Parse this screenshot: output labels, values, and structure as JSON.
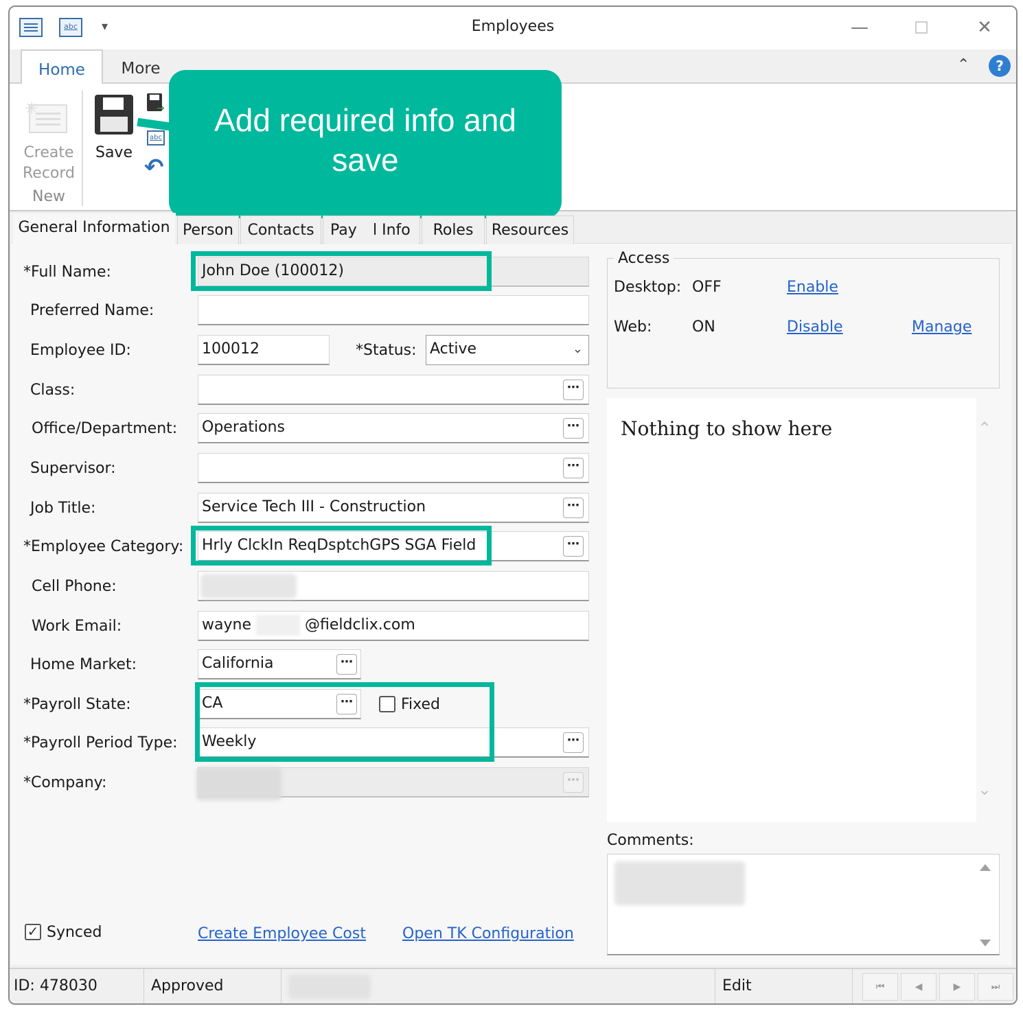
{
  "window": {
    "title": "Employees"
  },
  "ribbon": {
    "tabs": [
      {
        "label": "Home"
      },
      {
        "label": "More"
      }
    ],
    "create_record_label": "Create\nRecord",
    "group_new_label": "New",
    "save_label": "Save"
  },
  "callout": {
    "text": "Add required info and\nsave"
  },
  "form_tabs": [
    {
      "label": "General Information"
    },
    {
      "label": "Person"
    },
    {
      "label": "Contacts"
    },
    {
      "label": "Payroll Info"
    },
    {
      "label": "Roles"
    },
    {
      "label": "Resources"
    }
  ],
  "payroll_tab_left": "Pay",
  "payroll_tab_right": "l Info",
  "form": {
    "full_name": {
      "label": "*Full Name:",
      "value": "John Doe (100012)"
    },
    "preferred_name": {
      "label": "Preferred Name:",
      "value": ""
    },
    "employee_id": {
      "label": "Employee ID:",
      "value": "100012"
    },
    "status": {
      "label": "*Status:",
      "value": "Active"
    },
    "class": {
      "label": "Class:",
      "value": ""
    },
    "office_department": {
      "label": "Office/Department:",
      "value": "Operations"
    },
    "supervisor": {
      "label": "Supervisor:",
      "value": ""
    },
    "job_title": {
      "label": "Job Title:",
      "value": "Service Tech III - Construction"
    },
    "employee_category": {
      "label": "*Employee Category:",
      "value": "Hrly ClckIn ReqDsptchGPS SGA Field"
    },
    "cell_phone": {
      "label": "Cell Phone:",
      "value": ""
    },
    "work_email": {
      "label": "Work Email:",
      "value_prefix": "wayne",
      "value_suffix": "@fieldclix.com"
    },
    "home_market": {
      "label": "Home Market:",
      "value": "California"
    },
    "payroll_state": {
      "label": "*Payroll State:",
      "value": "CA",
      "fixed_label": "Fixed",
      "fixed_checked": false
    },
    "payroll_period_type": {
      "label": "*Payroll Period Type:",
      "value": "Weekly"
    },
    "company": {
      "label": "*Company:",
      "value": ""
    },
    "ellipsis": "⋯"
  },
  "access": {
    "title": "Access",
    "desktop": {
      "label": "Desktop:",
      "value": "OFF",
      "action": "Enable"
    },
    "web": {
      "label": "Web:",
      "value": "ON",
      "action": "Disable",
      "manage": "Manage"
    }
  },
  "side_panel": {
    "empty_text": "Nothing to show here"
  },
  "comments": {
    "label": "Comments:"
  },
  "footer": {
    "synced_label": "Synced",
    "synced_checked": true,
    "create_cost_link": "Create Employee Cost",
    "open_tk_link": "Open TK Configuration"
  },
  "status_bar": {
    "id": "ID: 478030",
    "state": "Approved",
    "mode": "Edit"
  },
  "icons": {
    "quick_access_1": "form-icon",
    "quick_access_2": "abc-icon",
    "customize": "dropdown-arrow-icon",
    "minimize": "minimize-icon",
    "maximize": "maximize-icon",
    "close": "close-icon",
    "collapse": "chevron-up-icon",
    "help": "help-icon",
    "save": "floppy-disk-icon",
    "undo": "undo-icon",
    "nav_first": "first-record-icon",
    "nav_prev": "previous-record-icon",
    "nav_next": "next-record-icon",
    "nav_last": "last-record-icon"
  },
  "colors": {
    "accent": "#00b89c",
    "link": "#2563c9",
    "ribbon_active": "#2b6cb5"
  }
}
